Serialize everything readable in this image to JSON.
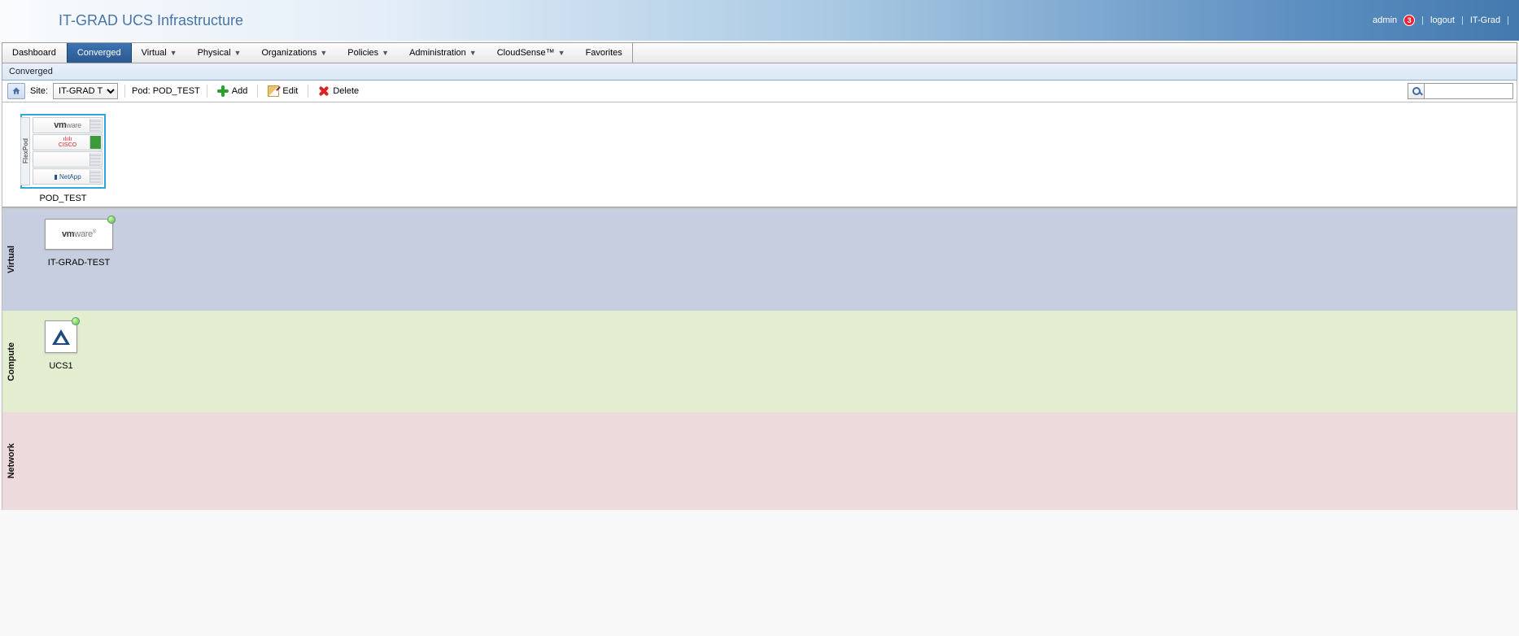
{
  "header": {
    "title": "IT-GRAD UCS Infrastructure",
    "user": "admin",
    "alerts": "3",
    "logout": "logout",
    "org": "IT-Grad"
  },
  "nav": {
    "items": [
      {
        "label": "Dashboard",
        "dropdown": false,
        "active": false
      },
      {
        "label": "Converged",
        "dropdown": false,
        "active": true
      },
      {
        "label": "Virtual",
        "dropdown": true,
        "active": false
      },
      {
        "label": "Physical",
        "dropdown": true,
        "active": false
      },
      {
        "label": "Organizations",
        "dropdown": true,
        "active": false
      },
      {
        "label": "Policies",
        "dropdown": true,
        "active": false
      },
      {
        "label": "Administration",
        "dropdown": true,
        "active": false
      },
      {
        "label": "CloudSense™",
        "dropdown": true,
        "active": false
      },
      {
        "label": "Favorites",
        "dropdown": false,
        "active": false
      }
    ]
  },
  "page_title": "Converged",
  "toolbar": {
    "site_label": "Site:",
    "site_value": "IT-GRAD T...",
    "pod_label": "Pod: POD_TEST",
    "add": "Add",
    "edit": "Edit",
    "delete": "Delete"
  },
  "pod": {
    "name": "POD_TEST",
    "side": "FlexPod",
    "rows": [
      "vmware",
      "cisco",
      "",
      "NetApp"
    ]
  },
  "stacks": {
    "virtual": {
      "label": "Virtual",
      "card": "vmware",
      "name": "IT-GRAD-TEST"
    },
    "compute": {
      "label": "Compute",
      "name": "UCS1"
    },
    "network": {
      "label": "Network"
    }
  }
}
